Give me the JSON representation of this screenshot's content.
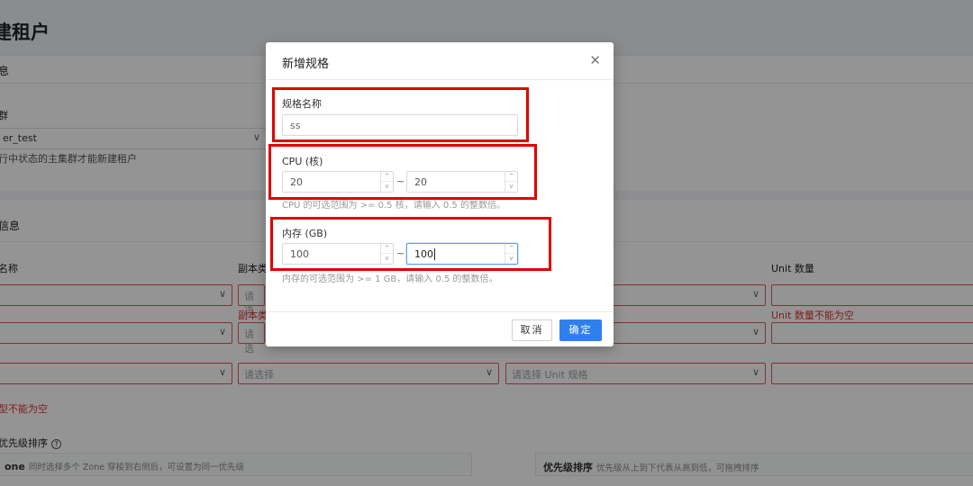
{
  "background": {
    "page_title": "建租户",
    "section1_title": "息",
    "cluster_label": "群",
    "cluster_value": "er_test",
    "cluster_hint": "行中状态的主集群才能新建租户",
    "section2_title": "信息",
    "col_name_label": "名称",
    "col_replica_label": "副本类",
    "col_unit_count_label": "Unit 数量",
    "placeholder_select": "请选择",
    "placeholder_short": "请选",
    "placeholder_unit_spec": "请选择 Unit 规格",
    "row1_left_value": "",
    "replica_error": "副本类",
    "unit_count_error": "Unit 数量不能为空",
    "type_error": "型不能为空",
    "priority_title": "优先级排序",
    "zone_box_title": "one",
    "zone_box_text": "同时选择多个 Zone 穿梭到右侧后，可设置为同一优先级",
    "priority_box_title": "优先级排序",
    "priority_box_text": "优先级从上到下代表从高到低，可拖拽排序"
  },
  "modal": {
    "title": "新增规格",
    "close_icon": "close-icon",
    "spec_name_label": "规格名称",
    "spec_name_value": "ss",
    "cpu_label": "CPU (核)",
    "cpu_min": "20",
    "cpu_max": "20",
    "cpu_hint": "CPU 的可选范围为 >= 0.5 核，请输入 0.5 的整数倍。",
    "mem_label": "内存 (GB)",
    "mem_min": "100",
    "mem_max": "100",
    "mem_hint": "内存的可选范围为 >= 1 GB，请输入 0.5 的整数倍。",
    "separator": "~",
    "cancel_label": "取消",
    "ok_label": "确定"
  },
  "colors": {
    "highlight_frame": "#e00000",
    "primary": "#2f80ed",
    "error": "#d33333"
  }
}
